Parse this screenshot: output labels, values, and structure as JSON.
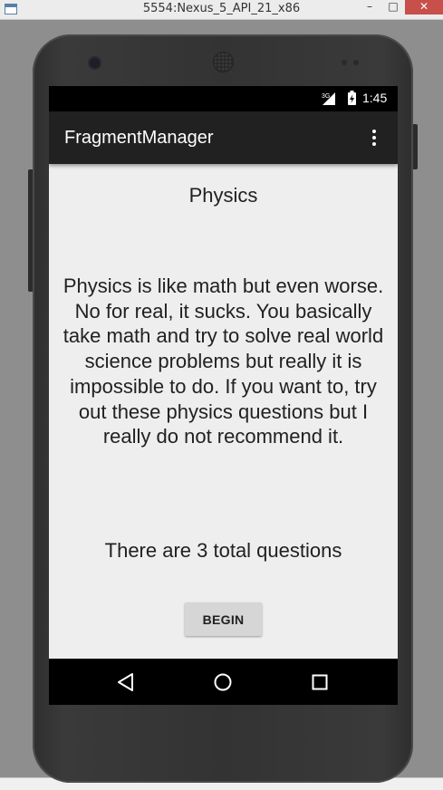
{
  "window": {
    "title": "5554:Nexus_5_API_21_x86",
    "minimize_glyph": "–",
    "maximize_glyph": "□",
    "close_glyph": "✕"
  },
  "status_bar": {
    "network_label": "3G",
    "time": "1:45"
  },
  "app_bar": {
    "title": "FragmentManager",
    "menu_icon": "overflow-menu-icon"
  },
  "content": {
    "subject_title": "Physics",
    "description": "Physics is like math but even worse. No for real, it sucks. You basically take math and try to solve real world science problems but really it is impossible to do. If you want to, try out these physics questions but I really do not recommend it.",
    "question_count": "There are 3 total questions",
    "begin_label": "BEGIN"
  },
  "nav_bar": {
    "icons": [
      "back-icon",
      "home-icon",
      "recents-icon"
    ]
  },
  "colors": {
    "app_bar": "#212121",
    "content_background": "#eeeeee",
    "button_background": "#d6d6d6",
    "text": "#212121"
  }
}
